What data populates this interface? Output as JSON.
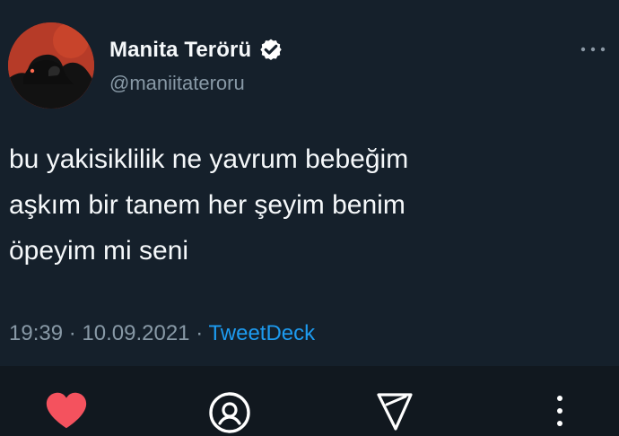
{
  "tweet": {
    "display_name": "Manita Terörü",
    "handle": "@maniitateroru",
    "body_lines": [
      "bu yakisiklilik ne yavrum bebeğim",
      "aşkım bir tanem her şeyim benim",
      "öpeyim mi seni"
    ],
    "time": "19:39",
    "date": "10.09.2021",
    "separator": "·",
    "source": "TweetDeck"
  },
  "icons": {
    "avatar": "profile-silhouette-avatar",
    "verified": "verified-badge-icon",
    "more": "more-horizontal-icon",
    "like": "heart-icon",
    "profile": "profile-circle-icon",
    "share": "send-arrow-icon",
    "overflow": "more-vertical-icon"
  },
  "colors": {
    "background": "#15202b",
    "action_bar": "#11181f",
    "text": "#f5f8fa",
    "muted": "#8899a6",
    "link": "#1d9bf0",
    "like": "#f4525e"
  }
}
